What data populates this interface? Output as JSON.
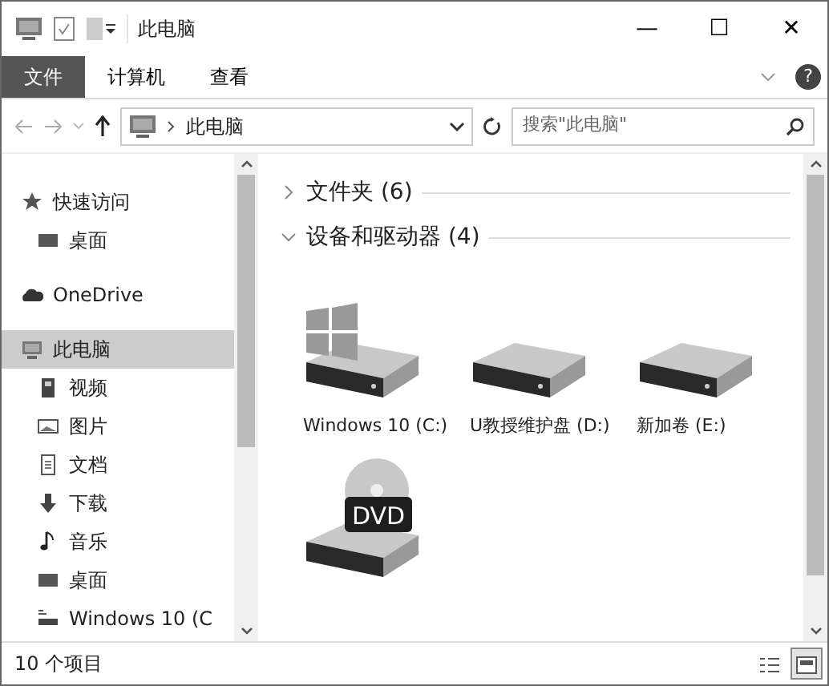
{
  "window": {
    "title": "此电脑",
    "controls": [
      "—",
      "☐",
      "✕"
    ]
  },
  "ribbon": {
    "tabs": [
      {
        "label": "文件",
        "selected": true
      },
      {
        "label": "计算机",
        "selected": false
      },
      {
        "label": "查看",
        "selected": false
      }
    ],
    "help": "?"
  },
  "address": {
    "path": "此电脑",
    "search_placeholder": "搜索\"此电脑\""
  },
  "sidebar": {
    "items": [
      {
        "label": "快速访问",
        "kind": "star",
        "selected": false,
        "children": [
          {
            "label": "桌面",
            "kind": "desktop",
            "selected": false
          }
        ]
      },
      {
        "label": "OneDrive",
        "kind": "cloud",
        "selected": false
      },
      {
        "label": "此电脑",
        "kind": "pc",
        "selected": true,
        "children": [
          {
            "label": "视频",
            "kind": "video",
            "selected": false
          },
          {
            "label": "图片",
            "kind": "picture",
            "selected": false
          },
          {
            "label": "文档",
            "kind": "doc",
            "selected": false
          },
          {
            "label": "下载",
            "kind": "download",
            "selected": false
          },
          {
            "label": "音乐",
            "kind": "music",
            "selected": false
          },
          {
            "label": "桌面",
            "kind": "desktop",
            "selected": false
          },
          {
            "label": "Windows 10 (C",
            "kind": "drive",
            "selected": false
          }
        ]
      }
    ]
  },
  "groups": [
    {
      "label": "文件夹 (6)",
      "expanded": false
    },
    {
      "label": "设备和驱动器 (4)",
      "expanded": true,
      "items": [
        {
          "label": "Windows 10 (C:)",
          "kind": "system"
        },
        {
          "label": "U教授维护盘 (D:)",
          "kind": "hdd"
        },
        {
          "label": "新加卷 (E:)",
          "kind": "hdd"
        },
        {
          "kind": "dvd",
          "badge": "DVD"
        }
      ]
    }
  ],
  "status_bar": {
    "count": "10 个项目",
    "views": [
      {
        "selected": false
      },
      {
        "selected": true
      }
    ]
  }
}
